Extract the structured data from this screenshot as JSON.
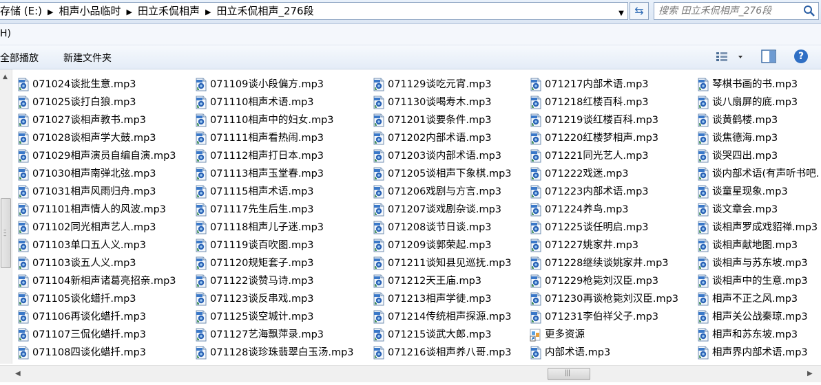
{
  "address_bar": {
    "crumbs": [
      "存储 (E:)",
      "相声小品临时",
      "田立禾侃相声",
      "田立禾侃相声_276段"
    ]
  },
  "search": {
    "placeholder": "搜索 田立禾侃相声_276段"
  },
  "menubar": {
    "partial_item": "H)"
  },
  "toolbar": {
    "play_all": "全部播放",
    "new_folder": "新建文件夹",
    "help": "?"
  },
  "icons": {
    "mp3": "media-audio-file-icon",
    "link": "shortcut-link-icon",
    "search": "search-icon",
    "refresh": "refresh-icon",
    "view": "view-options-icon",
    "pane": "preview-pane-icon",
    "help": "help-icon"
  },
  "columns": [
    {
      "items": [
        {
          "name": "071024谈批生意.mp3",
          "type": "mp3"
        },
        {
          "name": "071025谈打白狼.mp3",
          "type": "mp3"
        },
        {
          "name": "071027谈相声教书.mp3",
          "type": "mp3"
        },
        {
          "name": "071028谈相声学大鼓.mp3",
          "type": "mp3"
        },
        {
          "name": "071029相声演员自编自演.mp3",
          "type": "mp3"
        },
        {
          "name": "071030相声南弹北弦.mp3",
          "type": "mp3"
        },
        {
          "name": "071031相声风雨归舟.mp3",
          "type": "mp3"
        },
        {
          "name": "071101相声情人的风波.mp3",
          "type": "mp3"
        },
        {
          "name": "071102同光相声艺人.mp3",
          "type": "mp3"
        },
        {
          "name": "071103单口五人义.mp3",
          "type": "mp3"
        },
        {
          "name": "071103谈五人义.mp3",
          "type": "mp3"
        },
        {
          "name": "071104新相声诸葛亮招亲.mp3",
          "type": "mp3"
        },
        {
          "name": "071105谈化蜡扦.mp3",
          "type": "mp3"
        },
        {
          "name": "071106再谈化蜡扦.mp3",
          "type": "mp3"
        },
        {
          "name": "071107三侃化蜡扦.mp3",
          "type": "mp3"
        },
        {
          "name": "071108四谈化蜡扦.mp3",
          "type": "mp3"
        }
      ]
    },
    {
      "items": [
        {
          "name": "071109谈小段偏方.mp3",
          "type": "mp3"
        },
        {
          "name": "071110相声术语.mp3",
          "type": "mp3"
        },
        {
          "name": "071110相声中的妇女.mp3",
          "type": "mp3"
        },
        {
          "name": "071111相声看热闹.mp3",
          "type": "mp3"
        },
        {
          "name": "071112相声打日本.mp3",
          "type": "mp3"
        },
        {
          "name": "071113相声玉堂春.mp3",
          "type": "mp3"
        },
        {
          "name": "071115相声术语.mp3",
          "type": "mp3"
        },
        {
          "name": "071117先生后生.mp3",
          "type": "mp3"
        },
        {
          "name": "071118相声儿子迷.mp3",
          "type": "mp3"
        },
        {
          "name": "071119谈百吹图.mp3",
          "type": "mp3"
        },
        {
          "name": "071120规矩套子.mp3",
          "type": "mp3"
        },
        {
          "name": "071122谈赞马诗.mp3",
          "type": "mp3"
        },
        {
          "name": "071123谈反串戏.mp3",
          "type": "mp3"
        },
        {
          "name": "071125谈空城计.mp3",
          "type": "mp3"
        },
        {
          "name": "071127艺海飘萍录.mp3",
          "type": "mp3"
        },
        {
          "name": "071128谈珍珠翡翠白玉汤.mp3",
          "type": "mp3"
        }
      ]
    },
    {
      "items": [
        {
          "name": "071129谈吃元宵.mp3",
          "type": "mp3"
        },
        {
          "name": "071130谈喝寿木.mp3",
          "type": "mp3"
        },
        {
          "name": "071201谈要条件.mp3",
          "type": "mp3"
        },
        {
          "name": "071202内部术语.mp3",
          "type": "mp3"
        },
        {
          "name": "071203谈内部术语.mp3",
          "type": "mp3"
        },
        {
          "name": "071205谈相声下象棋.mp3",
          "type": "mp3"
        },
        {
          "name": "071206戏剧与方言.mp3",
          "type": "mp3"
        },
        {
          "name": "071207谈戏剧杂谈.mp3",
          "type": "mp3"
        },
        {
          "name": "071208谈节日谈.mp3",
          "type": "mp3"
        },
        {
          "name": "071209谈郭荣起.mp3",
          "type": "mp3"
        },
        {
          "name": "071211谈知县见巡抚.mp3",
          "type": "mp3"
        },
        {
          "name": "071212天王庙.mp3",
          "type": "mp3"
        },
        {
          "name": "071213相声学徒.mp3",
          "type": "mp3"
        },
        {
          "name": "071214传统相声探源.mp3",
          "type": "mp3"
        },
        {
          "name": "071215谈武大郎.mp3",
          "type": "mp3"
        },
        {
          "name": "071216谈相声养八哥.mp3",
          "type": "mp3"
        }
      ]
    },
    {
      "items": [
        {
          "name": "071217内部术语.mp3",
          "type": "mp3"
        },
        {
          "name": "071218红楼百科.mp3",
          "type": "mp3"
        },
        {
          "name": "071219谈红楼百科.mp3",
          "type": "mp3"
        },
        {
          "name": "071220红楼梦相声.mp3",
          "type": "mp3"
        },
        {
          "name": "071221同光艺人.mp3",
          "type": "mp3"
        },
        {
          "name": "071222戏迷.mp3",
          "type": "mp3"
        },
        {
          "name": "071223内部术语.mp3",
          "type": "mp3"
        },
        {
          "name": "071224养鸟.mp3",
          "type": "mp3"
        },
        {
          "name": "071225谈任明启.mp3",
          "type": "mp3"
        },
        {
          "name": "071227姚家井.mp3",
          "type": "mp3"
        },
        {
          "name": "071228继续谈姚家井.mp3",
          "type": "mp3"
        },
        {
          "name": "071229枪毙刘汉臣.mp3",
          "type": "mp3"
        },
        {
          "name": "071230再谈枪毙刘汉臣.mp3",
          "type": "mp3"
        },
        {
          "name": "071231李伯祥父子.mp3",
          "type": "mp3"
        },
        {
          "name": "更多资源",
          "type": "link"
        },
        {
          "name": "内部术语.mp3",
          "type": "mp3"
        }
      ]
    },
    {
      "items": [
        {
          "name": "琴棋书画的书.mp3",
          "type": "mp3"
        },
        {
          "name": "谈八扇屏的底.mp3",
          "type": "mp3"
        },
        {
          "name": "谈黄鹤楼.mp3",
          "type": "mp3"
        },
        {
          "name": "谈焦德海.mp3",
          "type": "mp3"
        },
        {
          "name": "谈哭四出.mp3",
          "type": "mp3"
        },
        {
          "name": "谈内部术语(有声听书吧.",
          "type": "mp3"
        },
        {
          "name": "谈童星现象.mp3",
          "type": "mp3"
        },
        {
          "name": "谈文章会.mp3",
          "type": "mp3"
        },
        {
          "name": "谈相声罗成戏貂禅.mp3",
          "type": "mp3"
        },
        {
          "name": "谈相声献地图.mp3",
          "type": "mp3"
        },
        {
          "name": "谈相声与苏东坡.mp3",
          "type": "mp3"
        },
        {
          "name": "谈相声中的生意.mp3",
          "type": "mp3"
        },
        {
          "name": "相声不正之风.mp3",
          "type": "mp3"
        },
        {
          "name": "相声关公战秦琼.mp3",
          "type": "mp3"
        },
        {
          "name": "相声和苏东坡.mp3",
          "type": "mp3"
        },
        {
          "name": "相声界内部术语.mp3",
          "type": "mp3"
        }
      ]
    }
  ]
}
